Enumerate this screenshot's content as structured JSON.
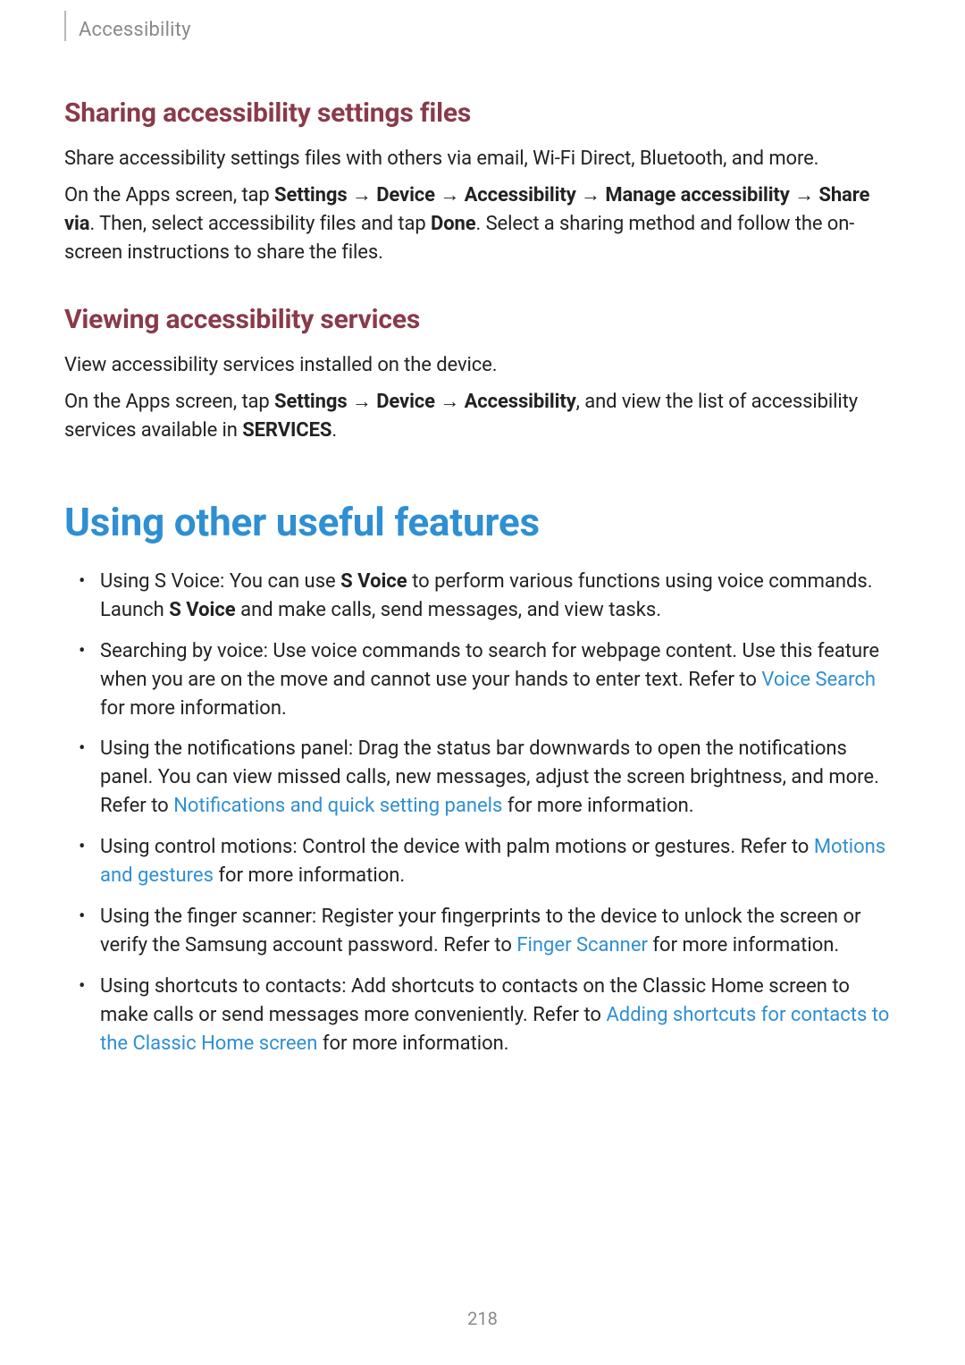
{
  "header": {
    "label": "Accessibility"
  },
  "section1": {
    "title": "Sharing accessibility settings files",
    "p1": "Share accessibility settings files with others via email, Wi-Fi Direct, Bluetooth, and more.",
    "p2": {
      "pre": "On the Apps screen, tap ",
      "b1": "Settings",
      "arr1": " → ",
      "b2": "Device",
      "arr2": " → ",
      "b3": "Accessibility",
      "arr3": " → ",
      "b4": "Manage accessibility",
      "arr4": " → ",
      "b5": "Share via",
      "mid": ". Then, select accessibility files and tap ",
      "b6": "Done",
      "post": ". Select a sharing method and follow the on-screen instructions to share the files."
    }
  },
  "section2": {
    "title": "Viewing accessibility services",
    "p1": "View accessibility services installed on the device.",
    "p2": {
      "pre": "On the Apps screen, tap ",
      "b1": "Settings",
      "arr1": " → ",
      "b2": "Device",
      "arr2": " → ",
      "b3": "Accessibility",
      "mid": ", and view the list of accessibility services available in ",
      "b4": "SERVICES",
      "post": "."
    }
  },
  "chapter": {
    "title": "Using other useful features"
  },
  "bullets": {
    "i0": {
      "a": "Using S Voice: You can use ",
      "b1": "S Voice",
      "b": " to perform various functions using voice commands. Launch ",
      "b2": "S Voice",
      "c": " and make calls, send messages, and view tasks."
    },
    "i1": {
      "a": "Searching by voice: Use voice commands to search for webpage content. Use this feature when you are on the move and cannot use your hands to enter text. Refer to ",
      "link": "Voice Search",
      "b": " for more information."
    },
    "i2": {
      "a": "Using the notifications panel: Drag the status bar downwards to open the notifications panel. You can view missed calls, new messages, adjust the screen brightness, and more. Refer to ",
      "link": "Notifications and quick setting panels",
      "b": " for more information."
    },
    "i3": {
      "a": "Using control motions: Control the device with palm motions or gestures. Refer to ",
      "link": "Motions and gestures",
      "b": " for more information."
    },
    "i4": {
      "a": "Using the finger scanner: Register your fingerprints to the device to unlock the screen or verify the Samsung account password. Refer to ",
      "link": "Finger Scanner",
      "b": " for more information."
    },
    "i5": {
      "a": "Using shortcuts to contacts: Add shortcuts to contacts on the Classic Home screen to make calls or send messages more conveniently. Refer to ",
      "link": "Adding shortcuts for contacts to the Classic Home screen",
      "b": " for more information."
    }
  },
  "page_number": "218"
}
